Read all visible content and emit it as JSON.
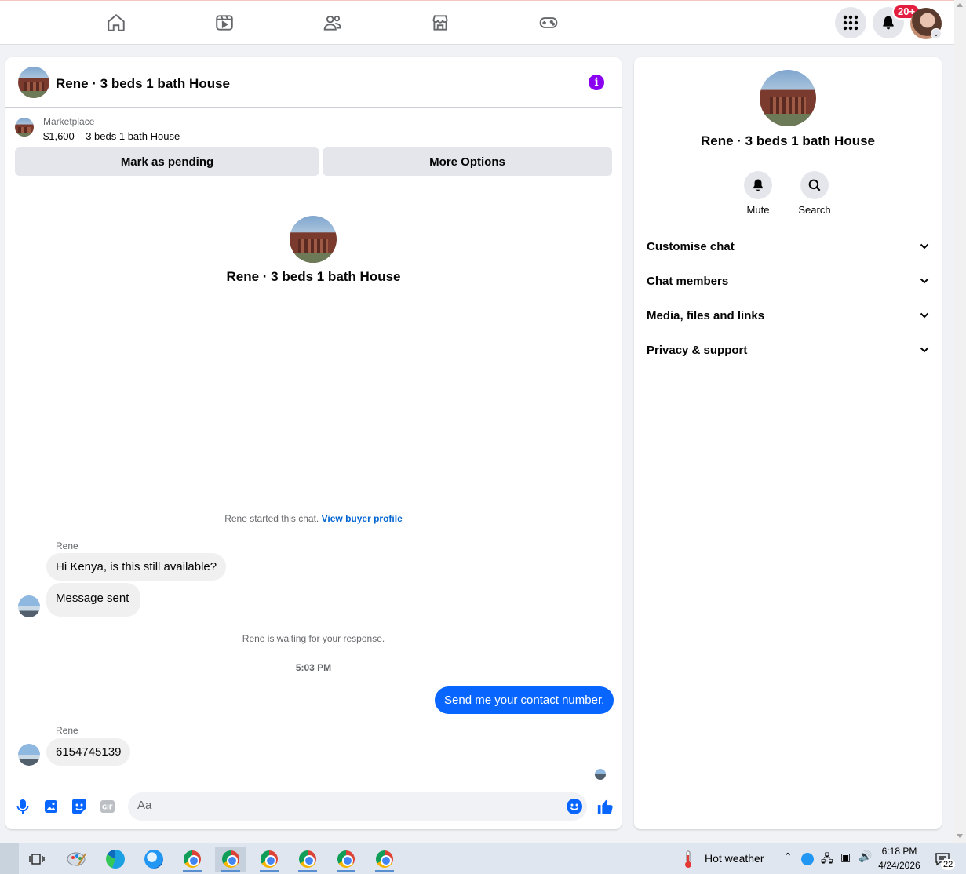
{
  "nav": {
    "tabs": [
      "home-icon",
      "video-icon",
      "friends-icon",
      "marketplace-icon",
      "gaming-icon"
    ],
    "notifications_badge": "20+"
  },
  "chat": {
    "title": "Rene · 3 beds 1 bath House",
    "marketplace_label": "Marketplace",
    "listing": "$1,600 – 3 beds 1 bath House",
    "mark_pending_label": "Mark as pending",
    "more_options_label": "More Options",
    "intro_title": "Rene · 3 beds 1 bath House",
    "started_text": "Rene started this chat.",
    "view_profile_link": "View buyer profile",
    "messages": [
      {
        "sender": "Rene",
        "text": "Hi Kenya, is this still available?"
      },
      {
        "text": "Message sent"
      },
      {
        "system": "Rene is waiting for your response."
      },
      {
        "time": "5:03 PM"
      },
      {
        "out": true,
        "text": "Send me your contact number."
      },
      {
        "sender": "Rene",
        "text": "6154745139"
      }
    ],
    "composer_placeholder": "Aa"
  },
  "side": {
    "title": "Rene · 3 beds 1 bath House",
    "mute_label": "Mute",
    "search_label": "Search",
    "sections": [
      "Customise chat",
      "Chat members",
      "Media, files and links",
      "Privacy & support"
    ]
  },
  "taskbar": {
    "weather": "Hot weather",
    "time": "6:18 PM",
    "date": "4/24/2026",
    "notification_count": "22"
  },
  "colors": {
    "accent": "#0866ff",
    "info": "#8a00f0",
    "badge": "#e41e3f"
  }
}
